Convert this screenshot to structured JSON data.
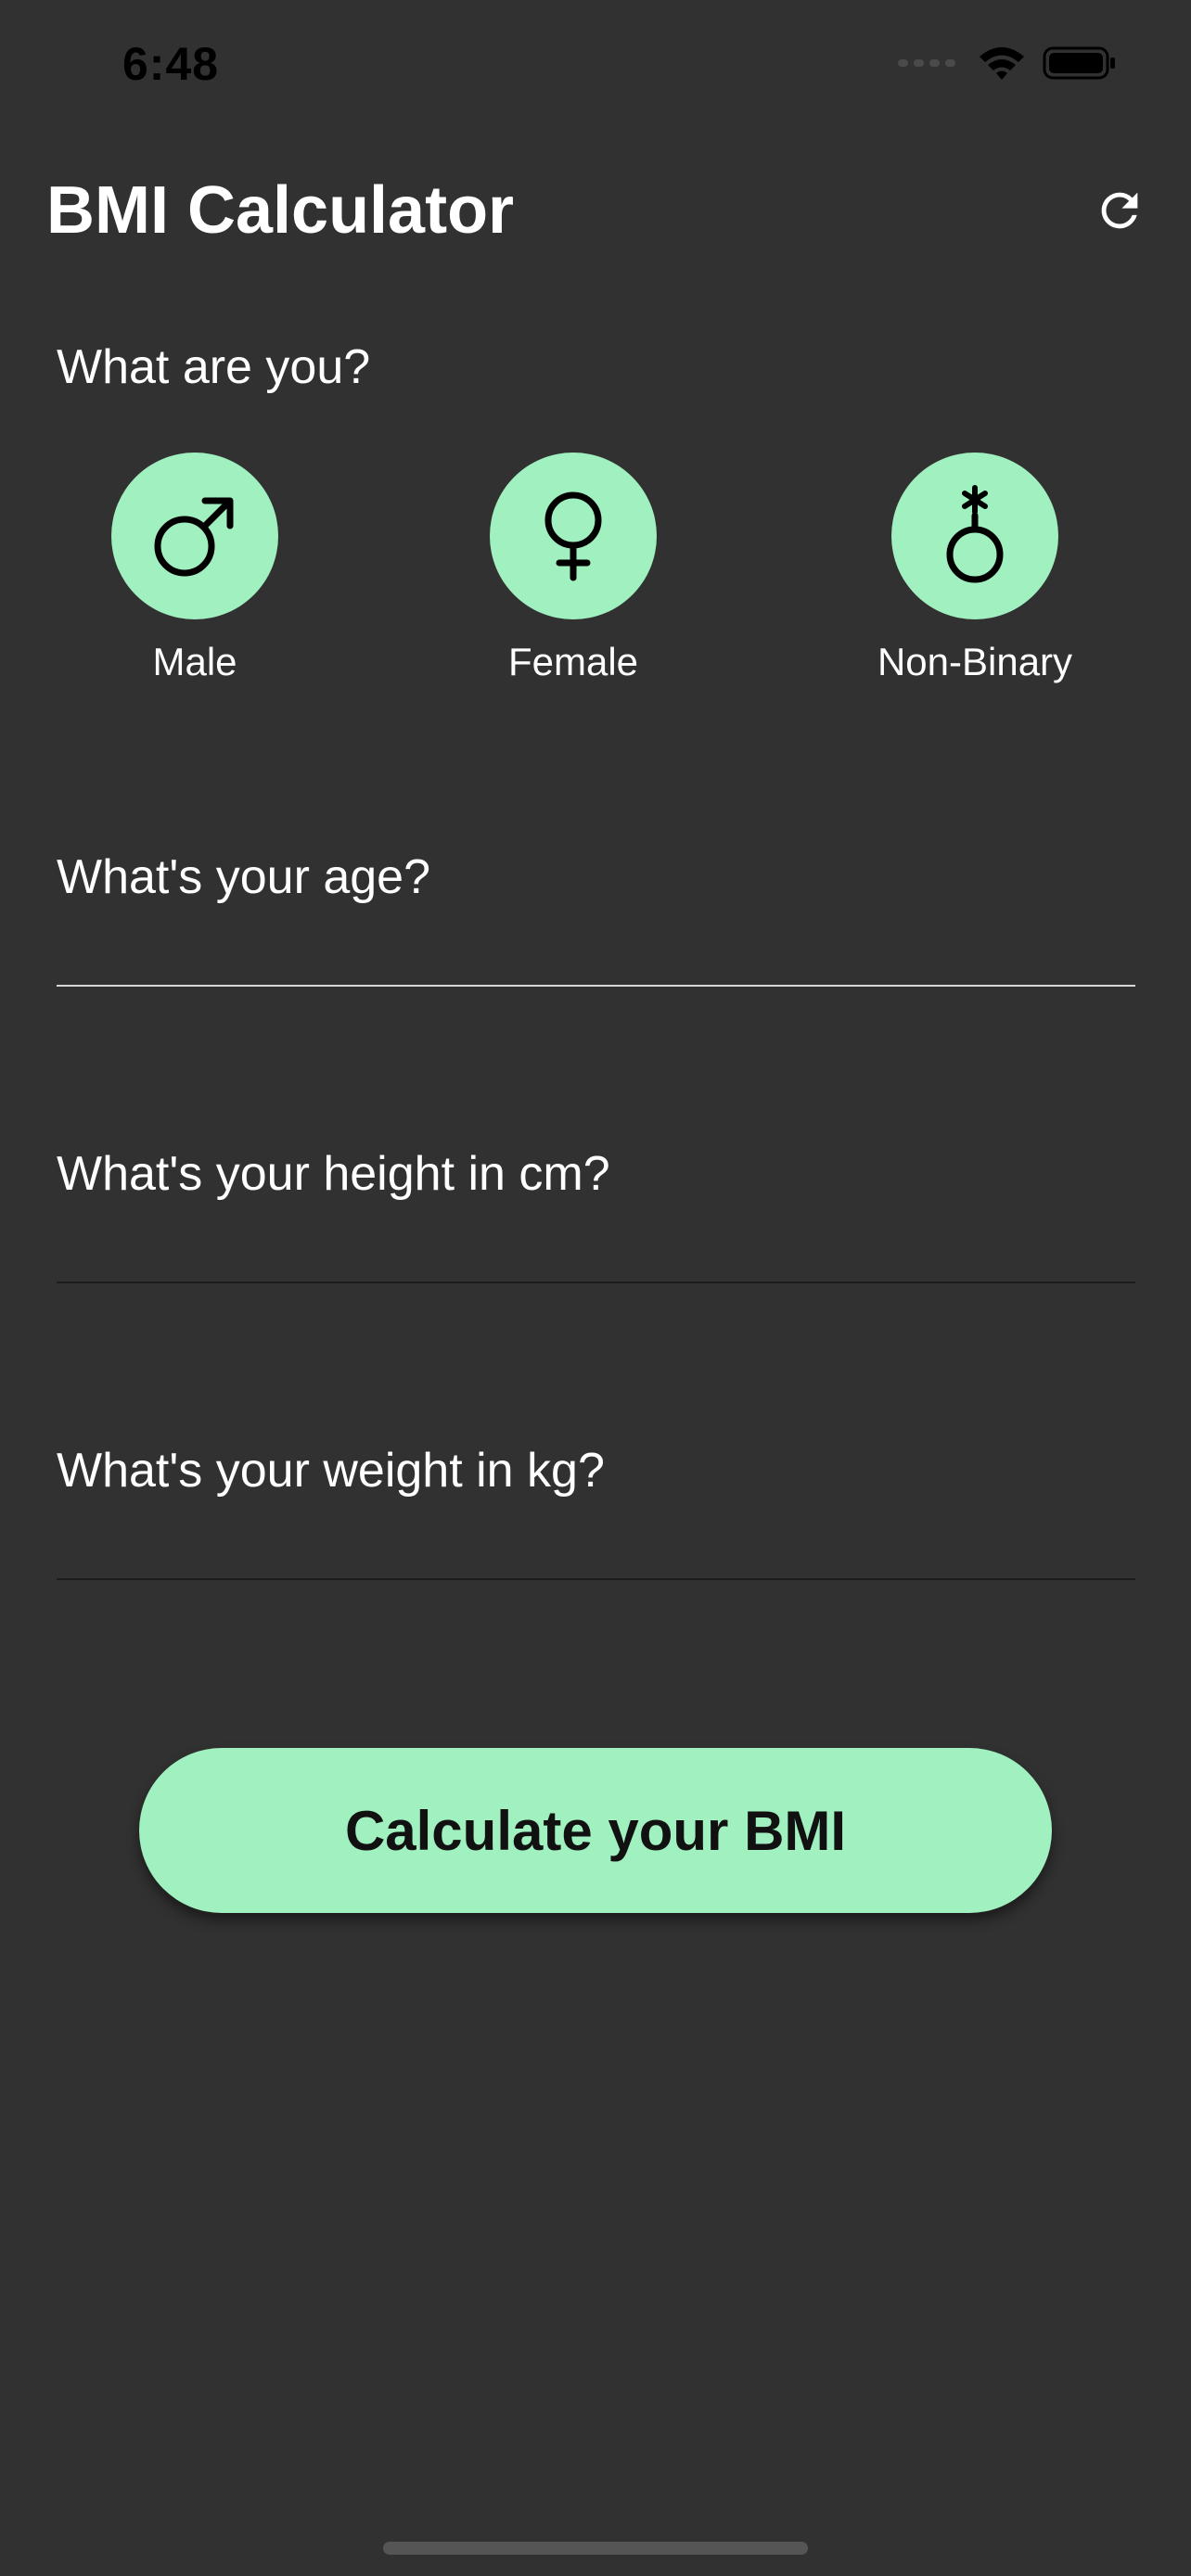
{
  "status_bar": {
    "time": "6:48",
    "icons": [
      "signal-icon",
      "wifi-icon",
      "battery-icon"
    ]
  },
  "app_bar": {
    "title": "BMI Calculator",
    "action_icon": "refresh-icon"
  },
  "gender": {
    "question": "What are you?",
    "options": [
      {
        "label": "Male",
        "icon": "male-symbol-icon"
      },
      {
        "label": "Female",
        "icon": "female-symbol-icon"
      },
      {
        "label": "Non-Binary",
        "icon": "non-binary-symbol-icon"
      }
    ]
  },
  "form": {
    "age": {
      "label": "What's your age?",
      "value": ""
    },
    "height": {
      "label": "What's your height in cm?",
      "value": ""
    },
    "weight": {
      "label": "What's your weight in kg?",
      "value": ""
    }
  },
  "actions": {
    "calculate_label": "Calculate your BMI"
  },
  "colors": {
    "background": "#313131",
    "accent": "#a0f0c0",
    "text": "#ffffff",
    "field_line_active": "#d8d8d8",
    "field_line_inactive": "#1c1c1c"
  }
}
